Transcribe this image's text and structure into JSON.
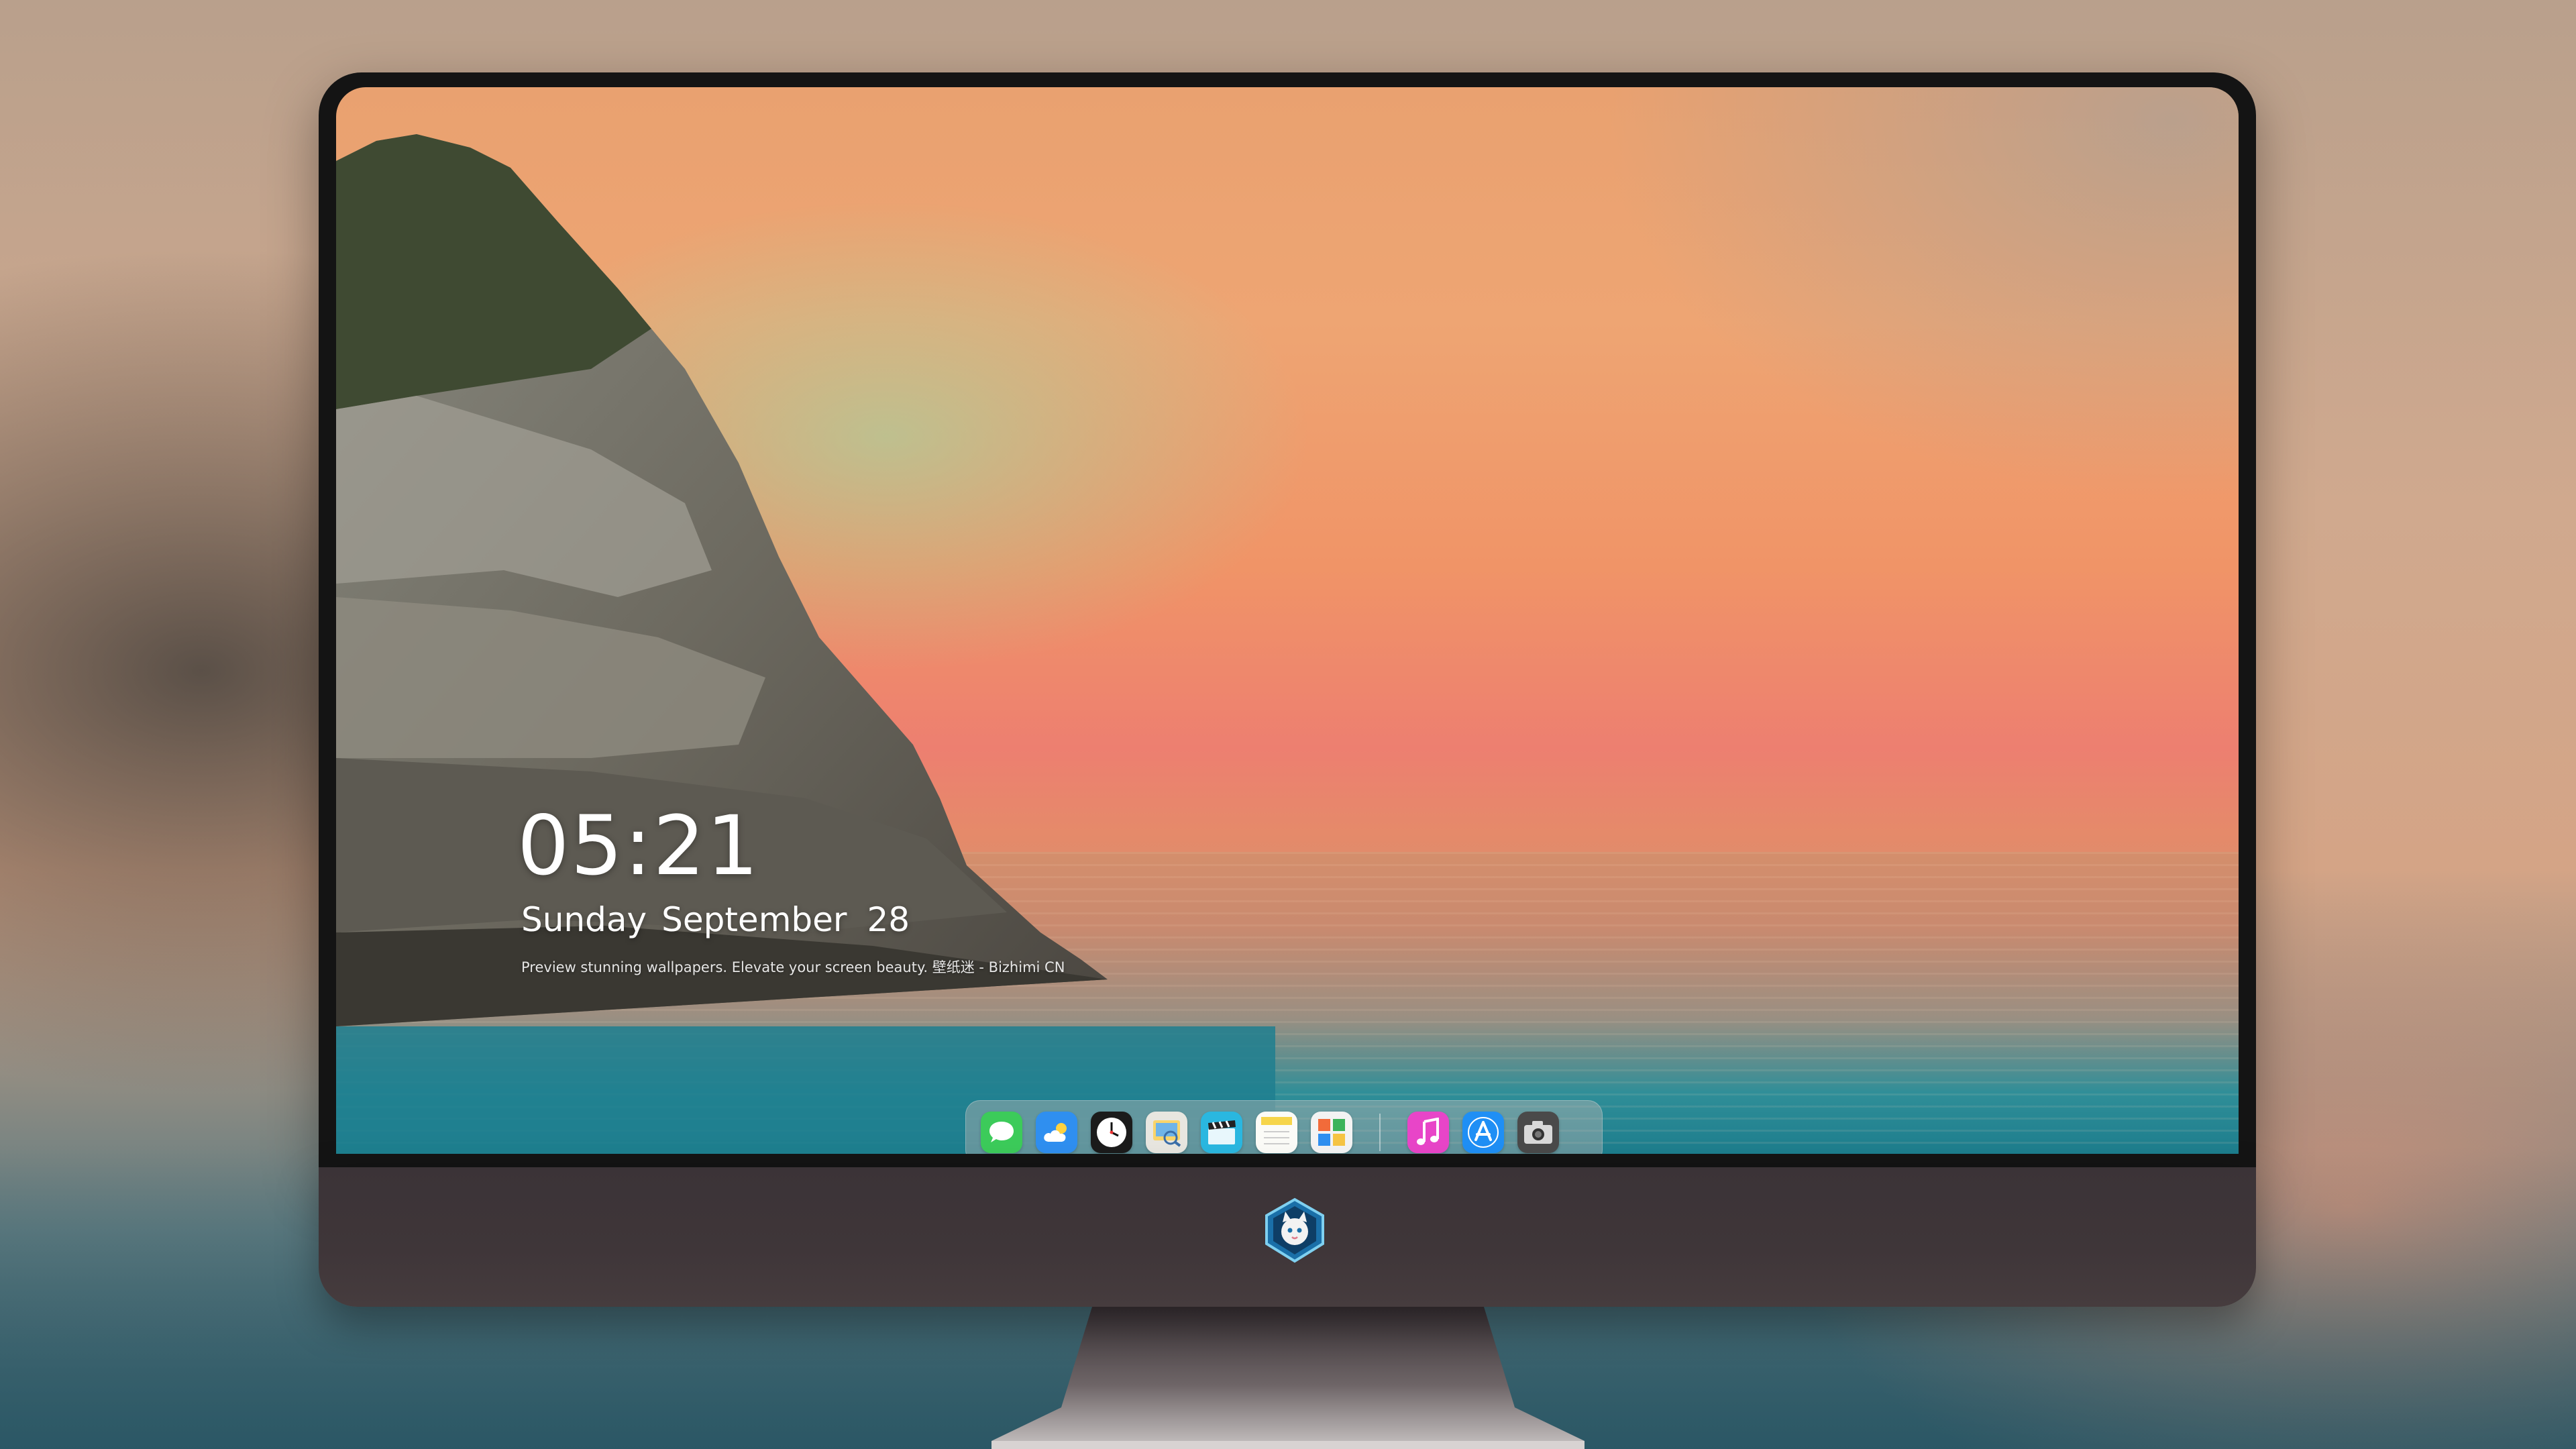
{
  "lock_screen": {
    "time": "05:21",
    "weekday": "Sunday",
    "month": "September",
    "day": "28",
    "tagline": "Preview stunning wallpapers. Elevate your screen beauty. 壁纸迷 - Bizhimi CN"
  },
  "dock": {
    "apps": [
      {
        "name": "messages",
        "icon": "speech-bubble",
        "color": "#3ccb5a"
      },
      {
        "name": "weather",
        "icon": "cloud-sun",
        "color": "#2f8ff0"
      },
      {
        "name": "clock",
        "icon": "clock-face",
        "color": "#1b1b1b"
      },
      {
        "name": "preview",
        "icon": "photo-viewer",
        "color": "#e8e6e0"
      },
      {
        "name": "clips",
        "icon": "clapperboard",
        "color": "#2ab7e0"
      },
      {
        "name": "notes",
        "icon": "notepad",
        "color": "#f6d54a"
      },
      {
        "name": "photo-collage",
        "icon": "collage",
        "color": "#f3f3f3"
      }
    ],
    "apps_right": [
      {
        "name": "music",
        "icon": "music-note",
        "color": "#e845c8"
      },
      {
        "name": "app-store",
        "icon": "app-store-a",
        "color": "#1f8ff5"
      },
      {
        "name": "camera",
        "icon": "camera",
        "color": "#4a4a4a"
      }
    ]
  },
  "colors": {
    "bezel": "#141414",
    "chin": "#3f3639",
    "sky_top": "#e9a170",
    "sky_mid": "#f09467",
    "sea": "#1d7d8d"
  },
  "chin_logo": {
    "icon": "cat-mascot-shield"
  }
}
